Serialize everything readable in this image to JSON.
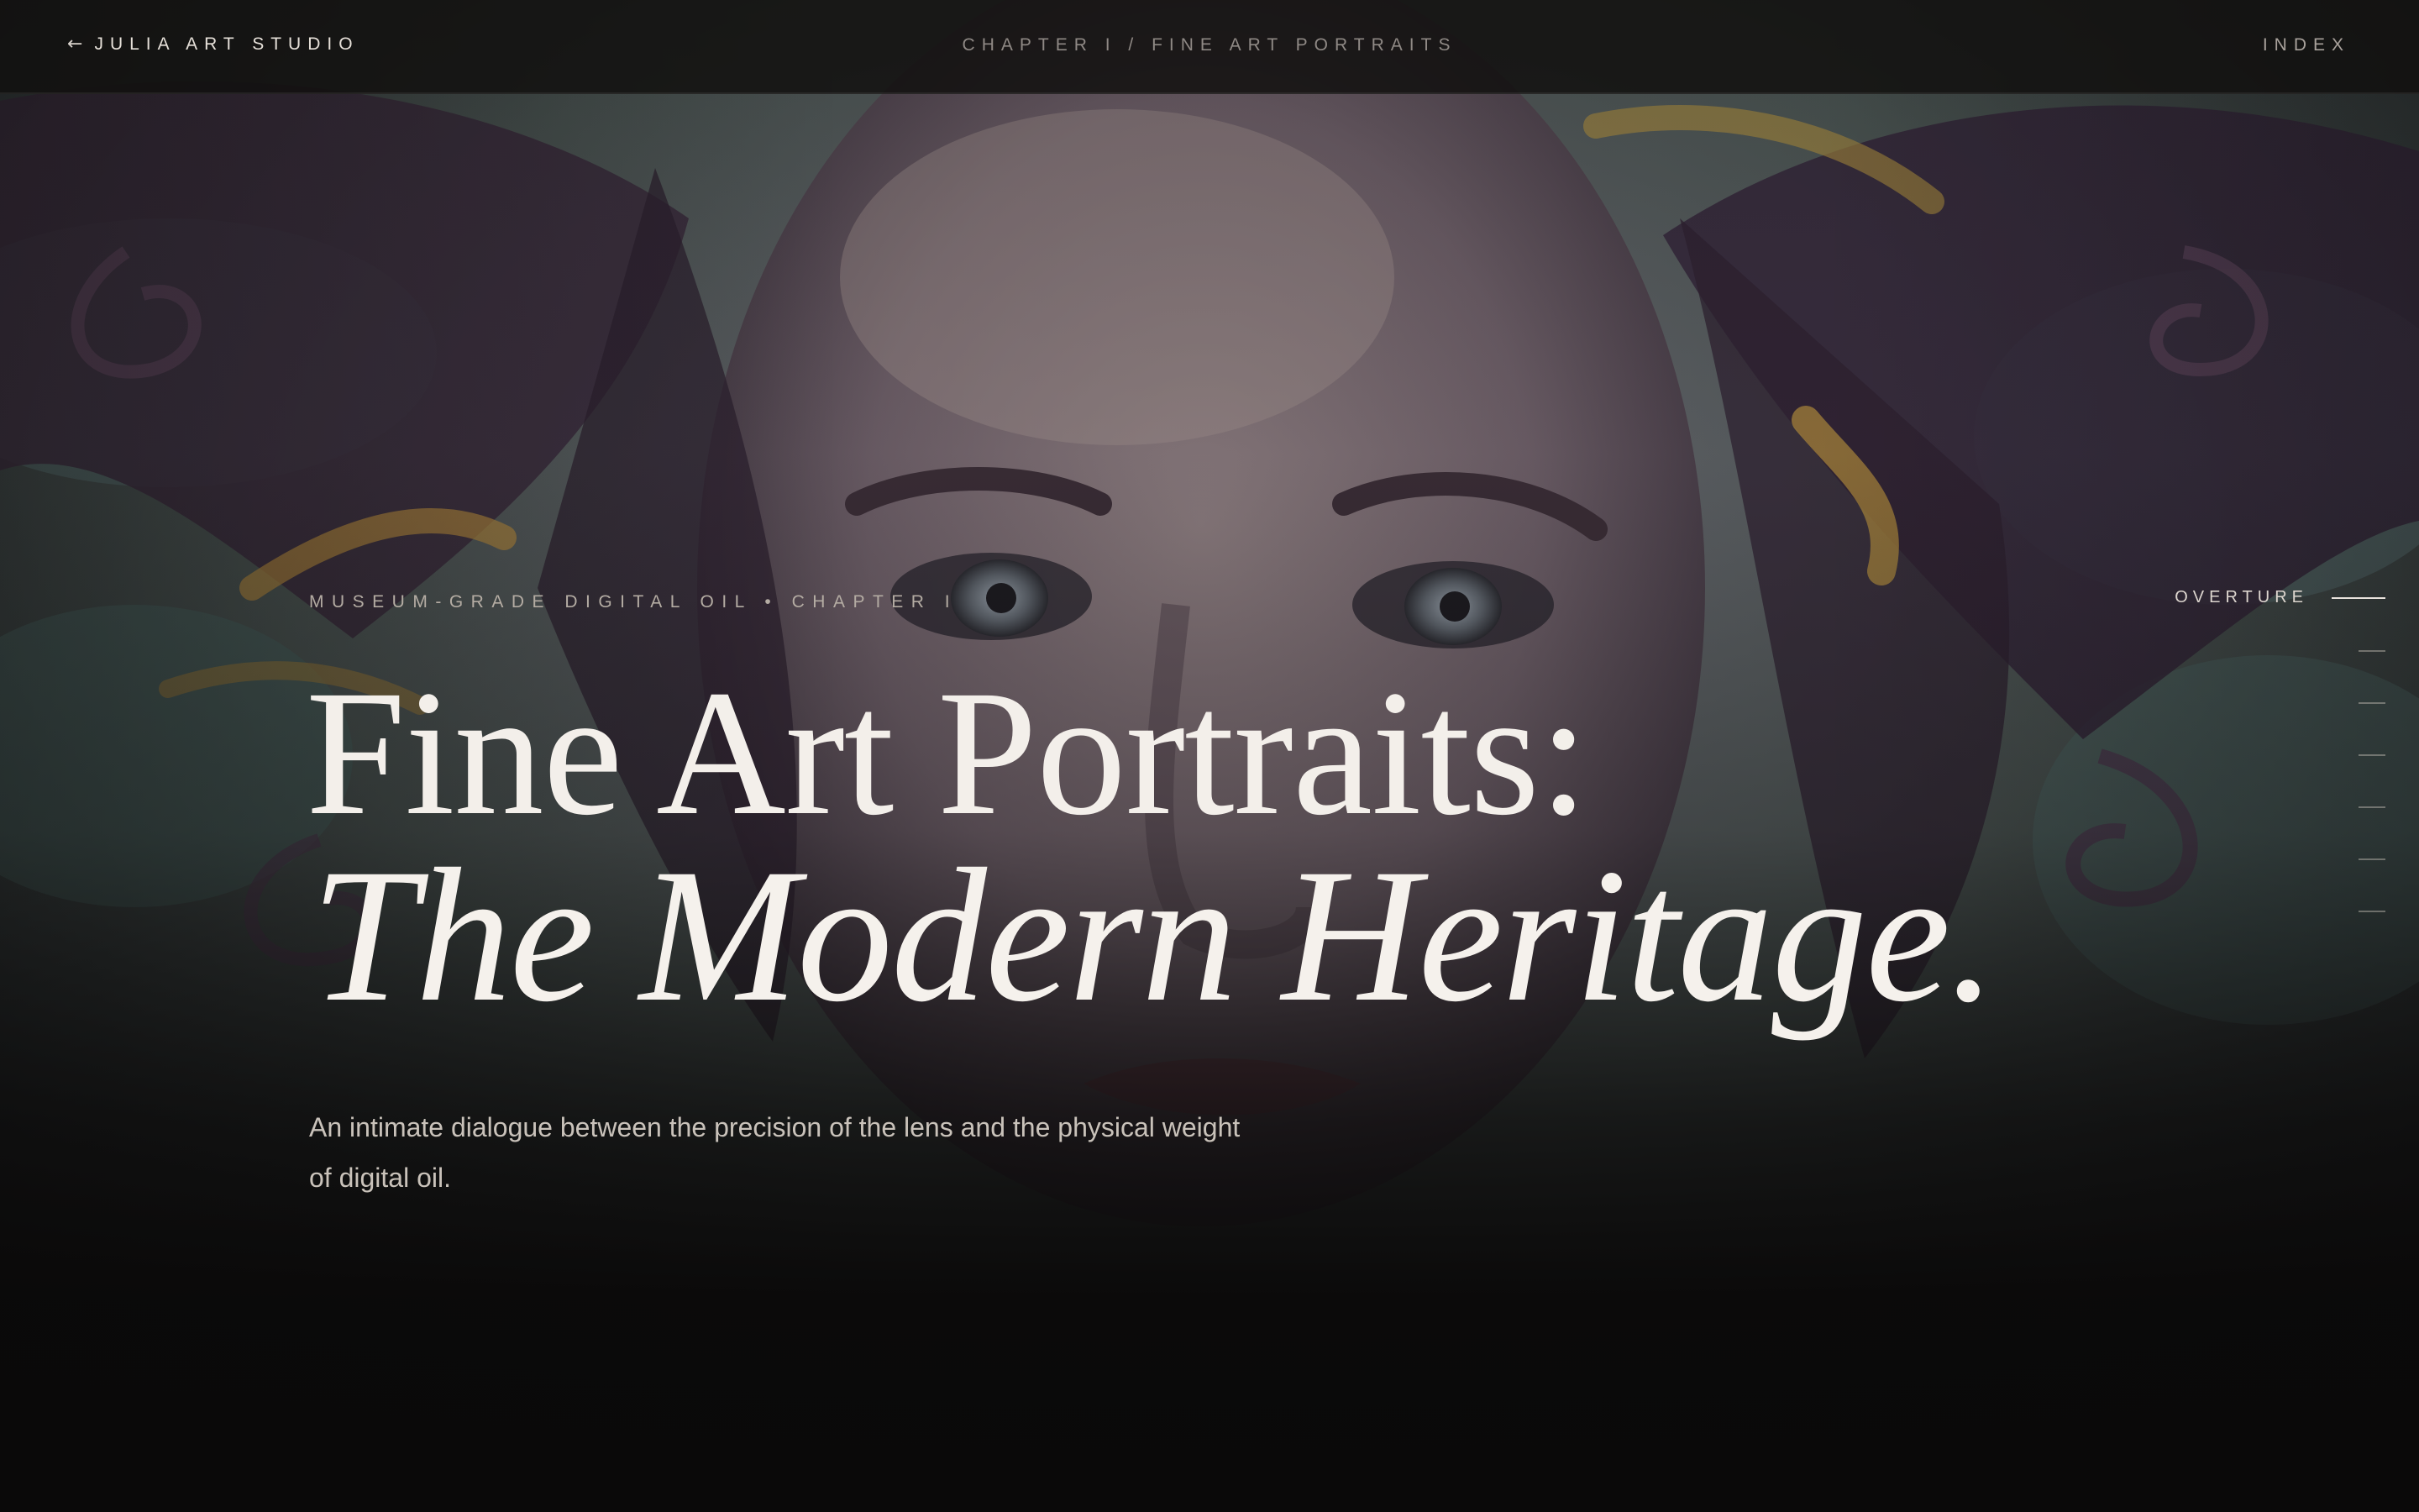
{
  "header": {
    "back_arrow": "←",
    "back_label": "JULIA ART STUDIO",
    "chapter": "CHAPTER I / FINE ART PORTRAITS",
    "index_label": "INDEX"
  },
  "hero": {
    "eyebrow": "MUSEUM-GRADE DIGITAL OIL • CHAPTER I",
    "title_line1": "Fine Art Portraits:",
    "title_line2": "The Modern Heritage.",
    "intro": "An intimate dialogue between the precision of the lens and the physical weight of digital oil.",
    "background_image": "oil-painting-portrait-of-woman"
  },
  "rail": {
    "active_label": "OVERTURE",
    "section_count": 7
  },
  "colors": {
    "page_background": "#0a0909",
    "title_text": "#f3efea",
    "muted_text": "#8f8985"
  }
}
